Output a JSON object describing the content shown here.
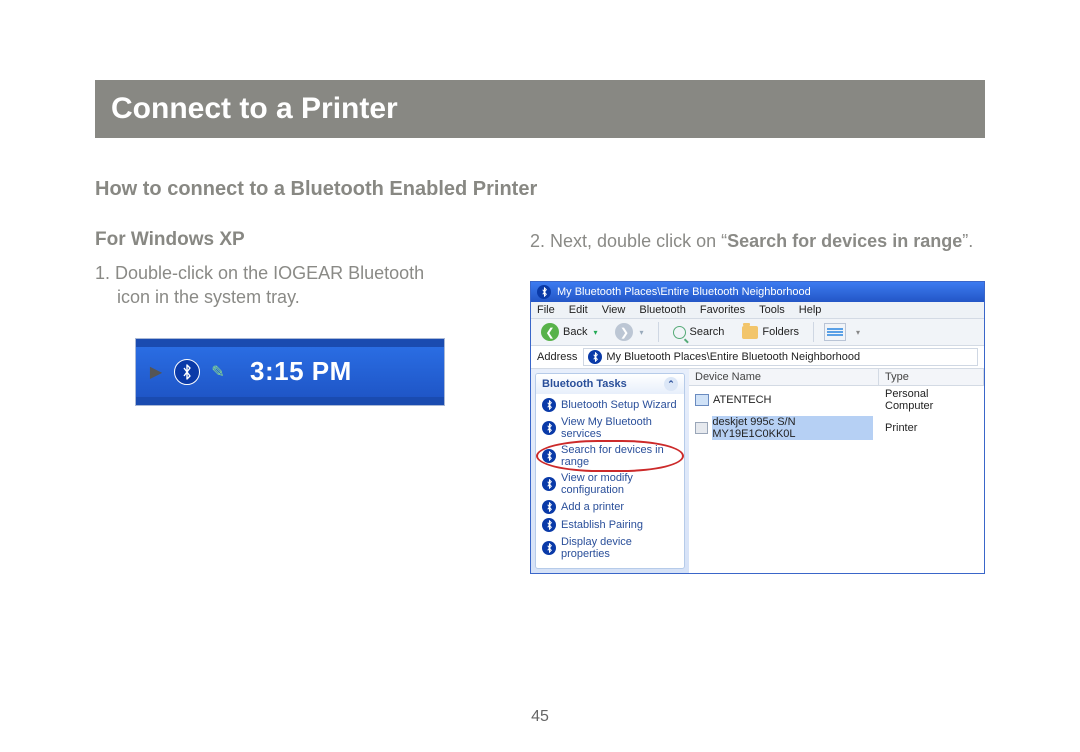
{
  "title": "Connect to a Printer",
  "subhead": "How to connect to a Bluetooth Enabled Printer",
  "page_number": "45",
  "left": {
    "os_heading": "For Windows XP",
    "step1_prefix": "1.  ",
    "step1_text": "Double-click on the IOGEAR Bluetooth icon in the system tray.",
    "systray": {
      "time": "3:15 PM"
    }
  },
  "right": {
    "step2_prefix": "2.  ",
    "step2_a": "Next, double click on “",
    "step2_bold": "Search for devices in range",
    "step2_b": "”."
  },
  "explorer": {
    "window_title": "My Bluetooth Places\\Entire Bluetooth Neighborhood",
    "menu": [
      "File",
      "Edit",
      "View",
      "Bluetooth",
      "Favorites",
      "Tools",
      "Help"
    ],
    "toolbar": {
      "back": "Back",
      "search": "Search",
      "folders": "Folders"
    },
    "address_label": "Address",
    "address_value": "My Bluetooth Places\\Entire Bluetooth Neighborhood",
    "side_head": "Bluetooth Tasks",
    "tasks": [
      "Bluetooth Setup Wizard",
      "View My Bluetooth services",
      "Search for devices in range",
      "View or modify configuration",
      "Add a printer",
      "Establish Pairing",
      "Display device properties"
    ],
    "columns": {
      "name": "Device Name",
      "type": "Type"
    },
    "rows": [
      {
        "name": "ATENTECH",
        "type": "Personal Computer"
      },
      {
        "name": "deskjet 995c S/N MY19E1C0KK0L",
        "type": "Printer"
      }
    ]
  }
}
